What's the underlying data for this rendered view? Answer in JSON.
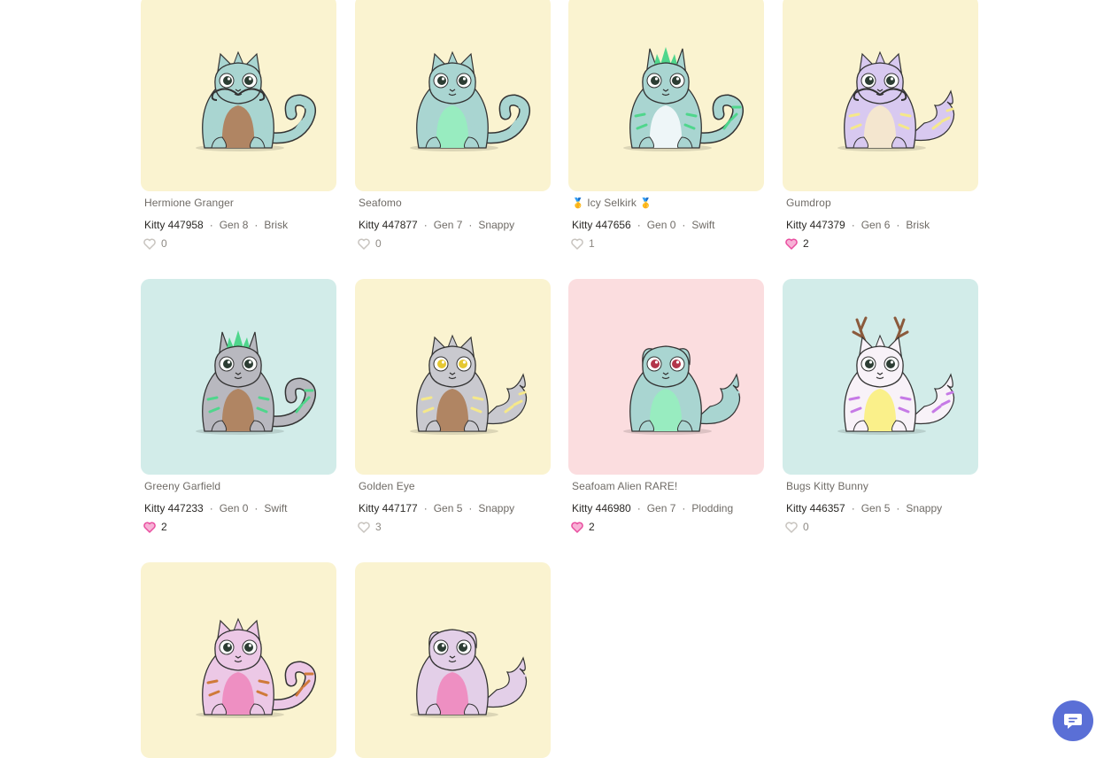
{
  "kitties": [
    {
      "name": "Hermione Granger",
      "id": "Kitty 447958",
      "gen": "Gen 8",
      "speed": "Brisk",
      "likes": "0",
      "liked": false,
      "bg": "#faf3d0",
      "body": "#a9d5d1",
      "belly": "#b08563",
      "accent": "#a9d5d1",
      "eye": "#2c3d33",
      "tail": "curl",
      "mustache": true,
      "ears": "tuft",
      "antlers": false,
      "medals": false
    },
    {
      "name": "Seafomo",
      "id": "Kitty 447877",
      "gen": "Gen 7",
      "speed": "Snappy",
      "likes": "0",
      "liked": false,
      "bg": "#faf3d0",
      "body": "#a9d5d1",
      "belly": "#98ecc0",
      "accent": "#a9d5d1",
      "eye": "#2c3d33",
      "tail": "curl",
      "mustache": false,
      "ears": "tuft",
      "antlers": false,
      "medals": false
    },
    {
      "name": "Icy Selkirk",
      "id": "Kitty 447656",
      "gen": "Gen 0",
      "speed": "Swift",
      "likes": "1",
      "liked": false,
      "bg": "#faf3d0",
      "body": "#a9d5d1",
      "belly": "#eef6f8",
      "accent": "#4fd68c",
      "eye": "#2c3d33",
      "tail": "curl",
      "mustache": false,
      "ears": "spike",
      "antlers": false,
      "medals": true
    },
    {
      "name": "Gumdrop",
      "id": "Kitty 447379",
      "gen": "Gen 6",
      "speed": "Brisk",
      "likes": "2",
      "liked": true,
      "bg": "#faf3d0",
      "body": "#d8c9f0",
      "belly": "#f4e6cf",
      "accent": "#f5e88a",
      "eye": "#2c3d33",
      "tail": "fluffy",
      "mustache": true,
      "ears": "tuft",
      "antlers": false,
      "medals": false
    },
    {
      "name": "Greeny Garfield",
      "id": "Kitty 447233",
      "gen": "Gen 0",
      "speed": "Swift",
      "likes": "2",
      "liked": true,
      "bg": "#d2ece9",
      "body": "#b8b8bf",
      "belly": "#b08563",
      "accent": "#4fd68c",
      "eye": "#2c3d33",
      "tail": "curl",
      "mustache": false,
      "ears": "spike",
      "antlers": false,
      "medals": false
    },
    {
      "name": "Golden Eye",
      "id": "Kitty 447177",
      "gen": "Gen 5",
      "speed": "Snappy",
      "likes": "3",
      "liked": false,
      "bg": "#faf3d0",
      "body": "#c9c9cf",
      "belly": "#b08563",
      "accent": "#f5e88a",
      "eye": "#e6c832",
      "tail": "fluffy",
      "mustache": false,
      "ears": "tuft",
      "antlers": false,
      "medals": false
    },
    {
      "name": "Seafoam Alien RARE!",
      "id": "Kitty 446980",
      "gen": "Gen 7",
      "speed": "Plodding",
      "likes": "2",
      "liked": true,
      "bg": "#fbdddf",
      "body": "#a9d5d1",
      "belly": "#98ecc0",
      "accent": "#a9d5d1",
      "eye": "#b3354a",
      "tail": "fluffy",
      "mustache": false,
      "ears": "round",
      "antlers": false,
      "medals": false
    },
    {
      "name": "Bugs Kitty Bunny",
      "id": "Kitty 446357",
      "gen": "Gen 5",
      "speed": "Snappy",
      "likes": "0",
      "liked": false,
      "bg": "#d2ece9",
      "body": "#f8f2f8",
      "belly": "#faf08a",
      "accent": "#c67ae6",
      "eye": "#2c3d33",
      "tail": "fluffy",
      "mustache": false,
      "ears": "tuft",
      "antlers": true,
      "medals": false
    },
    {
      "name": "",
      "id": "",
      "gen": "",
      "speed": "",
      "likes": "",
      "liked": false,
      "bg": "#faf3d0",
      "body": "#ecc8e6",
      "belly": "#ee8fc2",
      "accent": "#cf7a3a",
      "eye": "#2c3d33",
      "tail": "curl",
      "mustache": false,
      "ears": "tuft",
      "antlers": false,
      "medals": false
    },
    {
      "name": "",
      "id": "",
      "gen": "",
      "speed": "",
      "likes": "",
      "liked": false,
      "bg": "#faf3d0",
      "body": "#e3cfe8",
      "belly": "#ee8fc2",
      "accent": "#e3cfe8",
      "eye": "#2c3d33",
      "tail": "fluffy",
      "mustache": false,
      "ears": "round",
      "antlers": false,
      "medals": false
    }
  ],
  "colors": {
    "liked_heart": "#e94fa0",
    "unliked_heart": "#c8c4bf",
    "chat_button": "#5a6fd6"
  },
  "chat": {
    "icon": "chat-bubble-icon"
  }
}
